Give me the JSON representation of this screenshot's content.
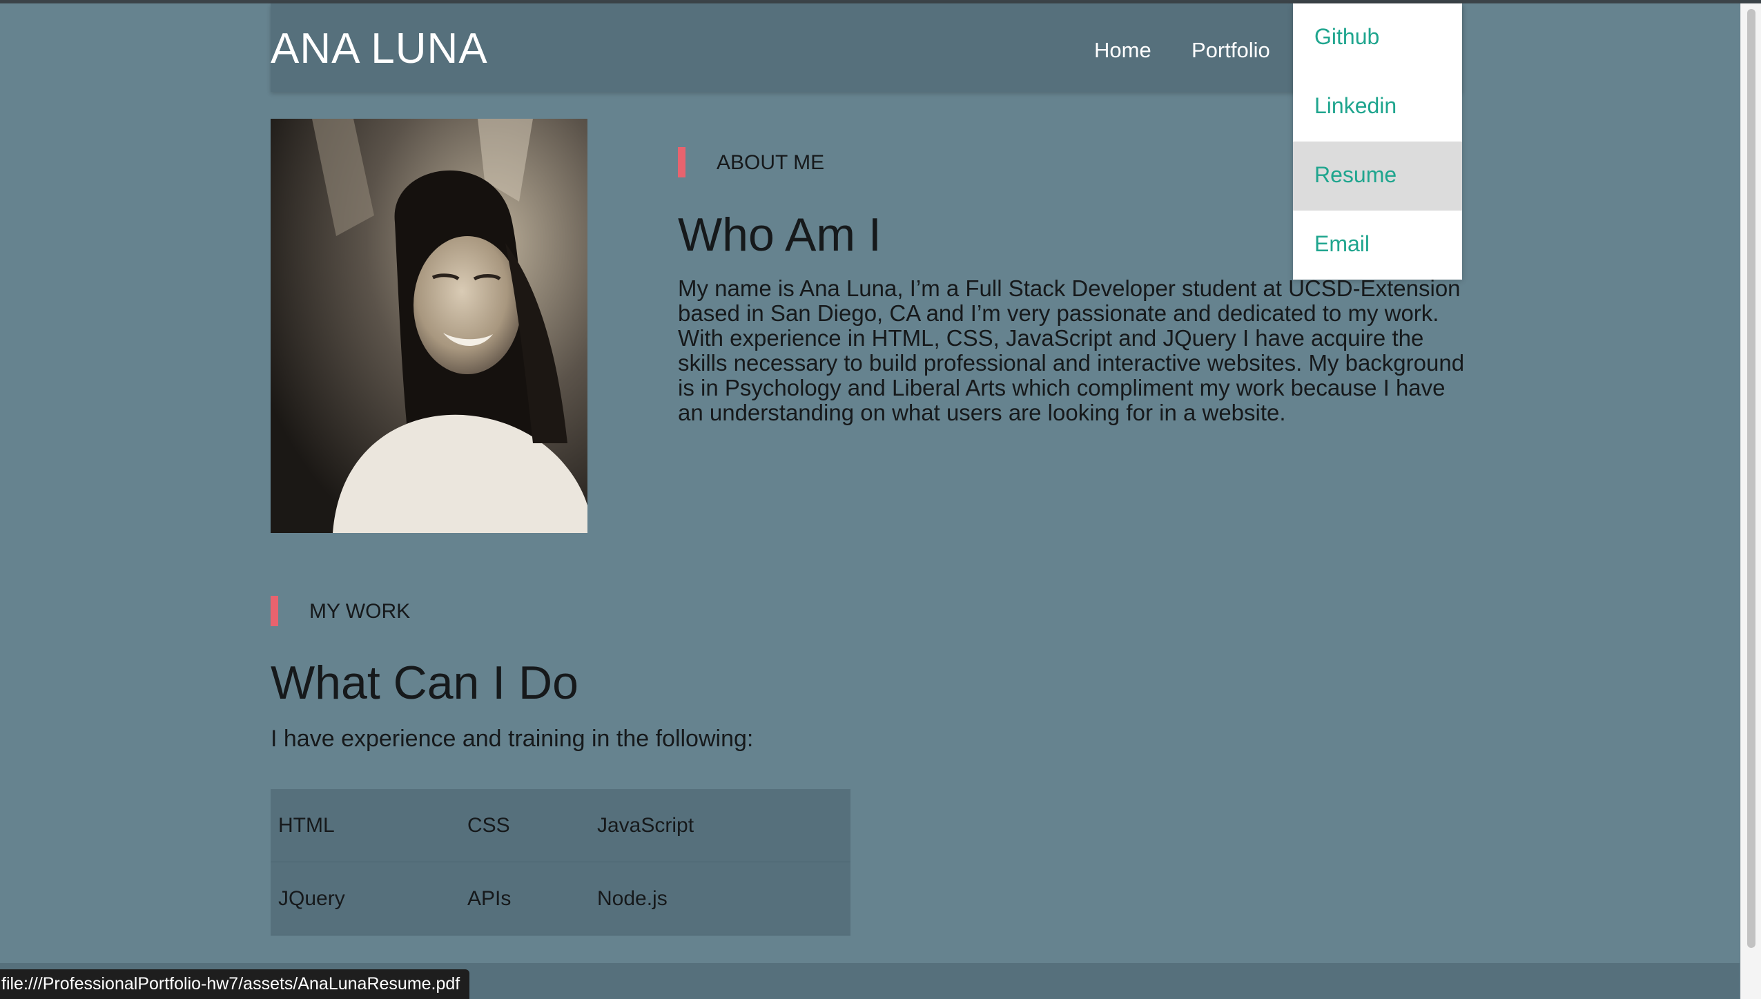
{
  "navbar": {
    "brand": "ANA LUNA",
    "links": [
      "Home",
      "Portfolio"
    ]
  },
  "dropdown": {
    "items": [
      "Github",
      "Linkedin",
      "Resume",
      "Email"
    ],
    "hovered": "Resume"
  },
  "about": {
    "label": "ABOUT ME",
    "heading": "Who Am I",
    "text": "My name is Ana Luna, I’m a Full Stack Developer student at UCSD-Extension based in San Diego, CA and I’m very passionate and dedicated to my work. With experience in HTML, CSS, JavaScript and JQuery I have acquire the skills necessary to build professional and interactive websites. My background is in Psychology and Liberal Arts which compliment my work because I have an understanding on what users are looking for in a website."
  },
  "work": {
    "label": "MY WORK",
    "heading": "What Can I Do",
    "intro": "I have experience and training in the following:",
    "skills": [
      [
        "HTML",
        "CSS",
        "JavaScript"
      ],
      [
        "JQuery",
        "APIs",
        "Node.js"
      ]
    ]
  },
  "status_bar": {
    "url": "file:///ProfessionalPortfolio-hw7/assets/AnaLunaResume.pdf"
  },
  "colors": {
    "page_background": "#66838f",
    "navbar_background": "#56707c",
    "accent_bar": "#e8636e",
    "dropdown_link": "#1fa58e",
    "dropdown_hover": "#dcdcdc"
  }
}
